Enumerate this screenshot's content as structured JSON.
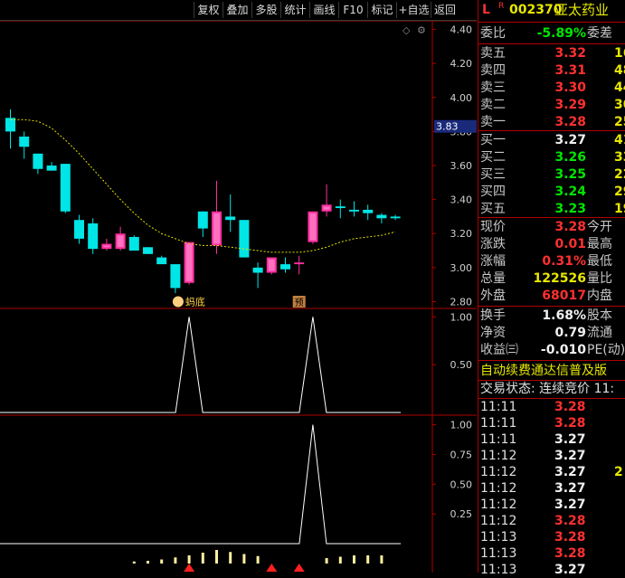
{
  "toolbar": {
    "buttons": [
      "复权",
      "叠加",
      "多股",
      "统计",
      "画线",
      "F10",
      "标记",
      "+自选",
      "返回"
    ]
  },
  "stock": {
    "prefix": "L",
    "flag": "R",
    "code": "002370",
    "name": "亚太药业"
  },
  "committee": {
    "label": "委比",
    "value": "-5.89%",
    "label2": "委差"
  },
  "asks": [
    {
      "label": "卖五",
      "price": "3.32",
      "vol": "16"
    },
    {
      "label": "卖四",
      "price": "3.31",
      "vol": "48"
    },
    {
      "label": "卖三",
      "price": "3.30",
      "vol": "44"
    },
    {
      "label": "卖二",
      "price": "3.29",
      "vol": "30"
    },
    {
      "label": "卖一",
      "price": "3.28",
      "vol": "25"
    }
  ],
  "bids": [
    {
      "label": "买一",
      "price": "3.27",
      "vol": "41"
    },
    {
      "label": "买二",
      "price": "3.26",
      "vol": "33"
    },
    {
      "label": "买三",
      "price": "3.25",
      "vol": "22"
    },
    {
      "label": "买四",
      "price": "3.24",
      "vol": "29"
    },
    {
      "label": "买五",
      "price": "3.23",
      "vol": "19"
    }
  ],
  "quote": [
    {
      "label": "现价",
      "value": "3.28",
      "label2": "今开",
      "color": "red"
    },
    {
      "label": "涨跌",
      "value": "0.01",
      "label2": "最高",
      "color": "red"
    },
    {
      "label": "涨幅",
      "value": "0.31%",
      "label2": "最低",
      "color": "red"
    },
    {
      "label": "总量",
      "value": "122526",
      "label2": "量比",
      "color": "yellow"
    },
    {
      "label": "外盘",
      "value": "68017",
      "label2": "内盘",
      "color": "red"
    }
  ],
  "fin": [
    {
      "label": "换手",
      "value": "1.68%",
      "label2": "股本"
    },
    {
      "label": "净资",
      "value": "0.79",
      "label2": "流通"
    },
    {
      "label": "收益㈢",
      "value": "-0.010",
      "label2": "PE(动)"
    }
  ],
  "ad_text": "自动续费通达信普及版",
  "trade_status": "交易状态: 连续竞价 11:",
  "ticks": [
    {
      "time": "11:11",
      "price": "3.28",
      "color": "red",
      "vol": ""
    },
    {
      "time": "11:11",
      "price": "3.28",
      "color": "red",
      "vol": ""
    },
    {
      "time": "11:11",
      "price": "3.27",
      "color": "white",
      "vol": ""
    },
    {
      "time": "11:12",
      "price": "3.27",
      "color": "white",
      "vol": ""
    },
    {
      "time": "11:12",
      "price": "3.27",
      "color": "white",
      "vol": "2"
    },
    {
      "time": "11:12",
      "price": "3.27",
      "color": "white",
      "vol": ""
    },
    {
      "time": "11:12",
      "price": "3.27",
      "color": "white",
      "vol": ""
    },
    {
      "time": "11:12",
      "price": "3.28",
      "color": "red",
      "vol": ""
    },
    {
      "time": "11:13",
      "price": "3.28",
      "color": "red",
      "vol": ""
    },
    {
      "time": "11:13",
      "price": "3.28",
      "color": "red",
      "vol": ""
    },
    {
      "time": "11:13",
      "price": "3.27",
      "color": "white",
      "vol": ""
    }
  ],
  "chart_data": {
    "type": "candlestick",
    "price_axis": {
      "ticks": [
        "4.40",
        "4.20",
        "4.00",
        "3.80",
        "3.60",
        "3.40",
        "3.20",
        "3.00",
        "2.80"
      ],
      "min": 2.76,
      "max": 4.44,
      "current_label": "3.83"
    },
    "candles": [
      {
        "o": 3.8,
        "h": 3.93,
        "l": 3.7,
        "c": 3.88,
        "color": "cyan"
      },
      {
        "o": 3.77,
        "h": 3.8,
        "l": 3.64,
        "c": 3.71,
        "color": "cyan"
      },
      {
        "o": 3.67,
        "h": 3.67,
        "l": 3.55,
        "c": 3.58,
        "color": "cyan"
      },
      {
        "o": 3.6,
        "h": 3.62,
        "l": 3.57,
        "c": 3.57,
        "color": "cyan"
      },
      {
        "o": 3.61,
        "h": 3.61,
        "l": 3.32,
        "c": 3.33,
        "color": "cyan"
      },
      {
        "o": 3.28,
        "h": 3.31,
        "l": 3.14,
        "c": 3.17,
        "color": "cyan"
      },
      {
        "o": 3.26,
        "h": 3.29,
        "l": 3.08,
        "c": 3.11,
        "color": "cyan"
      },
      {
        "o": 3.11,
        "h": 3.17,
        "l": 3.1,
        "c": 3.14,
        "color": "pink"
      },
      {
        "o": 3.11,
        "h": 3.24,
        "l": 3.1,
        "c": 3.2,
        "color": "pink"
      },
      {
        "o": 3.18,
        "h": 3.19,
        "l": 3.1,
        "c": 3.1,
        "color": "cyan"
      },
      {
        "o": 3.12,
        "h": 3.12,
        "l": 3.08,
        "c": 3.08,
        "color": "cyan"
      },
      {
        "o": 3.06,
        "h": 3.07,
        "l": 3.02,
        "c": 3.02,
        "color": "cyan"
      },
      {
        "o": 3.02,
        "h": 3.02,
        "l": 2.85,
        "c": 2.88,
        "color": "cyan"
      },
      {
        "o": 2.91,
        "h": 3.15,
        "l": 2.9,
        "c": 3.15,
        "color": "pink"
      },
      {
        "o": 3.23,
        "h": 3.33,
        "l": 3.18,
        "c": 3.33,
        "color": "cyan"
      },
      {
        "o": 3.13,
        "h": 3.51,
        "l": 3.08,
        "c": 3.33,
        "color": "pink"
      },
      {
        "o": 3.3,
        "h": 3.43,
        "l": 3.21,
        "c": 3.28,
        "color": "cyan"
      },
      {
        "o": 3.28,
        "h": 3.28,
        "l": 3.06,
        "c": 3.06,
        "color": "cyan"
      },
      {
        "o": 3.0,
        "h": 3.03,
        "l": 2.88,
        "c": 2.97,
        "color": "cyan"
      },
      {
        "o": 2.97,
        "h": 3.06,
        "l": 2.96,
        "c": 3.06,
        "color": "pink"
      },
      {
        "o": 3.02,
        "h": 3.06,
        "l": 2.97,
        "c": 2.99,
        "color": "cyan"
      },
      {
        "o": 3.02,
        "h": 3.07,
        "l": 2.96,
        "c": 3.03,
        "color": "pink"
      },
      {
        "o": 3.15,
        "h": 3.33,
        "l": 3.14,
        "c": 3.33,
        "color": "pink"
      },
      {
        "o": 3.33,
        "h": 3.49,
        "l": 3.3,
        "c": 3.37,
        "color": "pink"
      },
      {
        "o": 3.36,
        "h": 3.4,
        "l": 3.29,
        "c": 3.35,
        "color": "cyan"
      },
      {
        "o": 3.34,
        "h": 3.39,
        "l": 3.3,
        "c": 3.33,
        "color": "cyan"
      },
      {
        "o": 3.34,
        "h": 3.37,
        "l": 3.28,
        "c": 3.32,
        "color": "cyan"
      },
      {
        "o": 3.31,
        "h": 3.32,
        "l": 3.26,
        "c": 3.29,
        "color": "cyan"
      },
      {
        "o": 3.3,
        "h": 3.31,
        "l": 3.28,
        "c": 3.29,
        "color": "cyan"
      }
    ],
    "ma_line": [
      3.87,
      3.87,
      3.86,
      3.82,
      3.75,
      3.67,
      3.58,
      3.49,
      3.4,
      3.32,
      3.25,
      3.2,
      3.17,
      3.14,
      3.13,
      3.13,
      3.12,
      3.11,
      3.1,
      3.09,
      3.09,
      3.09,
      3.1,
      3.12,
      3.15,
      3.17,
      3.18,
      3.19,
      3.21
    ],
    "annotation_bottom": "蚂底",
    "annotation_pre": "预",
    "ind1_axis": {
      "ticks": [
        "1.00",
        "0.50"
      ],
      "min": 0,
      "max": 1.05
    },
    "ind1_peaks": [
      13,
      22
    ],
    "ind2_axis": {
      "ticks": [
        "1.00",
        "0.75",
        "0.50",
        "0.25"
      ],
      "min": 0,
      "max": 1.05
    },
    "ind2_peaks": [
      22
    ],
    "ind2_bars": [
      0,
      0,
      0,
      0,
      0,
      0,
      0,
      0,
      0,
      0.015,
      0.02,
      0.03,
      0.045,
      0.06,
      0.08,
      0.1,
      0.085,
      0.07,
      0.055,
      0,
      0,
      0,
      0,
      0.04,
      0.05,
      0.06,
      0.06,
      0.06,
      0
    ],
    "ind2_arrows": [
      13,
      19,
      21
    ]
  }
}
